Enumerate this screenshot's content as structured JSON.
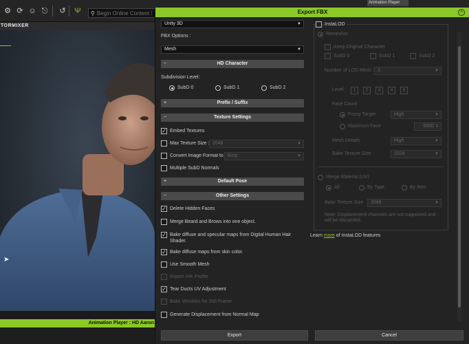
{
  "app": {
    "search_placeholder": "Begin Online Content S",
    "brand": "TORMIXER",
    "status_text": "Animation Player : HD Aaron",
    "right_tab": "Animation Player"
  },
  "dialog": {
    "title": "Export FBX",
    "target_value": "Unity 3D",
    "fbx_options_label": "FBX Options :",
    "fbx_options_value": "Mesh",
    "hd_character": {
      "header": "HD Character",
      "subdivision_label": "Subdivision Level:",
      "options": [
        "SubD 0",
        "SubD 1",
        "SubD 2"
      ],
      "selected": 0
    },
    "prefix_suffix_header": "Prefix / Suffix",
    "texture_settings": {
      "header": "Texture Settings",
      "embed_textures": "Embed Textures",
      "max_texture_size": "Max Texture Size :",
      "max_texture_value": "2048",
      "convert_image_format": "Convert Image Format to",
      "convert_value": "Bmp",
      "multiple_subd_normals": "Multiple SubD Normals"
    },
    "default_pose_header": "Default Pose",
    "other_settings": {
      "header": "Other Settings",
      "delete_hidden_faces": "Delete Hidden Faces",
      "merge_beard": "Merge Beard and Brows into one object.",
      "bake_diffuse_specular": "Bake diffuse and specular maps from Digital Human Hair Shader.",
      "bake_diffuse_skin": "Bake diffuse maps from skin color.",
      "use_smooth_mesh": "Use Smooth Mesh",
      "export_hik_profile": "Export HIK Profile",
      "tear_ducts": "Tear Ducts UV Adjustment",
      "bake_wrinkles": "Bake Wrinkles for Still Frame",
      "generate_displacement": "Generate Displacement from Normal Map"
    },
    "instalod": {
      "label": "InstaLOD",
      "remesher": "Remesher",
      "keep_original": "Keep Original Character",
      "subd_options": [
        "SubD 0",
        "SubD 1",
        "SubD 2"
      ],
      "lod_mesh_label": "Number of LOD Mesh :",
      "lod_mesh_value": "3",
      "level_label": "Level :",
      "levels": [
        "1",
        "2",
        "3",
        "4",
        "5"
      ],
      "face_count": "Face Count",
      "fuzzy_target": "Fuzzy Target",
      "fuzzy_value": "High",
      "maximum_face": "Maximum Face",
      "maximum_face_value": "5000",
      "mesh_details": "Mesh Details",
      "mesh_details_value": "High",
      "bake_texture_size": "Bake Texture Size",
      "bake_texture_value": "1024",
      "merge_material": "Merge Material (UV)",
      "merge_all": "All",
      "merge_by_type": "By Type",
      "merge_by_item": "By Item",
      "merge_bake_texture": "Bake Texture Size",
      "merge_bake_value": "2048",
      "note": "Note: Displacement channels are not supported and will be discarded.",
      "learn_prefix": "Learn",
      "learn_link": "more",
      "learn_suffix": "of InstaLOD features"
    },
    "export_button": "Export",
    "cancel_button": "Cancel"
  },
  "colors": {
    "accent": "#8ac926",
    "panel": "#232323",
    "section": "#4a4a4a"
  }
}
